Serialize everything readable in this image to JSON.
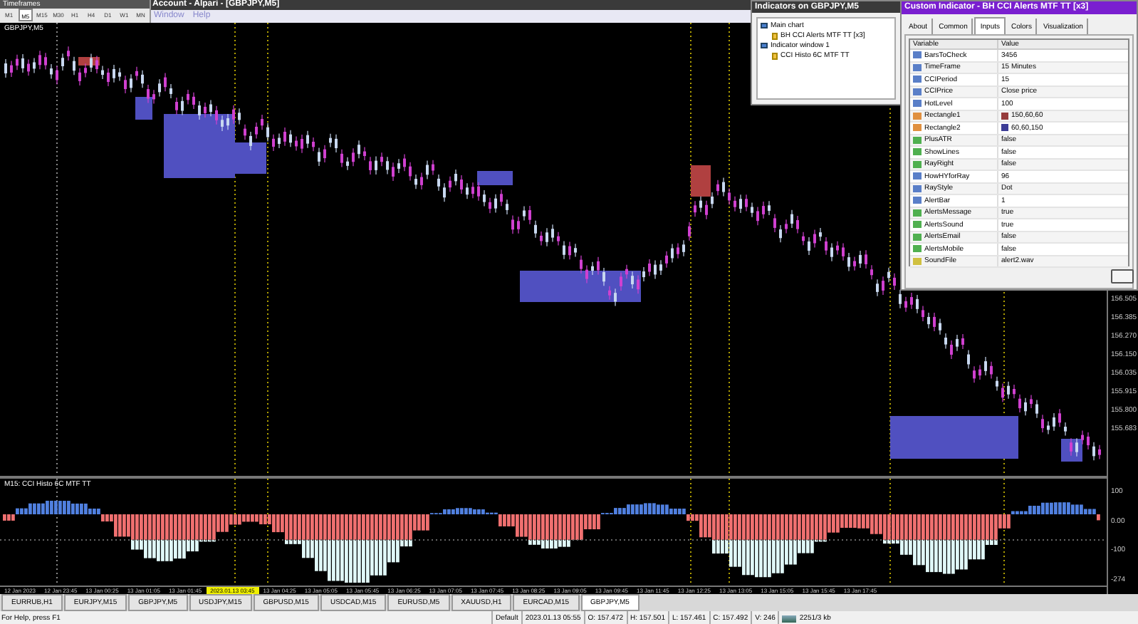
{
  "window": {
    "title": "Account - Alpari - [GBPJPY,M5]"
  },
  "menu": [
    "Window",
    "Help"
  ],
  "timeframes_toolbar": {
    "title": "Timeframes",
    "buttons": [
      {
        "label": "M1",
        "selected": false
      },
      {
        "label": "M5",
        "selected": true
      },
      {
        "label": "M15",
        "selected": false
      },
      {
        "label": "M30",
        "selected": false
      },
      {
        "label": "H1",
        "selected": false
      },
      {
        "label": "H4",
        "selected": false
      },
      {
        "label": "D1",
        "selected": false
      },
      {
        "label": "W1",
        "selected": false
      },
      {
        "label": "MN",
        "selected": false
      }
    ]
  },
  "chart": {
    "symbol_label": "GBPJPY,M5",
    "price_labels": [
      "156.505",
      "156.385",
      "156.270",
      "156.150",
      "156.035",
      "155.915",
      "155.800",
      "155.683"
    ],
    "indicator_label": "M15: CCI Histo 6C MTF TT",
    "indicator_levels": [
      "100",
      "0.00",
      "-100",
      "-274"
    ],
    "time_labels": [
      {
        "text": "12 Jan 2023",
        "highlighted": false
      },
      {
        "text": "12 Jan 23:45",
        "highlighted": false
      },
      {
        "text": "13 Jan 00:25",
        "highlighted": false
      },
      {
        "text": "13 Jan 01:05",
        "highlighted": false
      },
      {
        "text": "13 Jan 01:45",
        "highlighted": false
      },
      {
        "text": "2023.01.13 03:45",
        "highlighted": true
      },
      {
        "text": "13 Jan 04:25",
        "highlighted": false
      },
      {
        "text": "13 Jan 05:05",
        "highlighted": false
      },
      {
        "text": "13 Jan 05:45",
        "highlighted": false
      },
      {
        "text": "13 Jan 06:25",
        "highlighted": false
      },
      {
        "text": "13 Jan 07:05",
        "highlighted": false
      },
      {
        "text": "13 Jan 07:45",
        "highlighted": false
      },
      {
        "text": "13 Jan 08:25",
        "highlighted": false
      },
      {
        "text": "13 Jan 09:05",
        "highlighted": false
      },
      {
        "text": "13 Jan 09:45",
        "highlighted": false
      },
      {
        "text": "13 Jan 11:45",
        "highlighted": false
      },
      {
        "text": "13 Jan 12:25",
        "highlighted": false
      },
      {
        "text": "13 Jan 13:05",
        "highlighted": false
      },
      {
        "text": "13 Jan 15:05",
        "highlighted": false
      },
      {
        "text": "13 Jan 15:45",
        "highlighted": false
      },
      {
        "text": "13 Jan 17:45",
        "highlighted": false
      }
    ]
  },
  "indicators_dialog": {
    "title": "Indicators on GBPJPY,M5",
    "tree": [
      {
        "label": "Main chart",
        "children": [
          {
            "label": "BH CCI Alerts MTF TT [x3]"
          }
        ]
      },
      {
        "label": "Indicator window 1",
        "children": [
          {
            "label": "CCI Histo 6C MTF TT"
          }
        ]
      }
    ]
  },
  "custom_indicator_dialog": {
    "title": "Custom Indicator - BH CCI Alerts MTF TT [x3]",
    "tabs": [
      {
        "label": "About",
        "selected": false
      },
      {
        "label": "Common",
        "selected": false
      },
      {
        "label": "Inputs",
        "selected": true
      },
      {
        "label": "Colors",
        "selected": false
      },
      {
        "label": "Visualization",
        "selected": false
      }
    ],
    "columns": [
      "Variable",
      "Value"
    ],
    "rows": [
      {
        "kind": "number",
        "variable": "BarsToCheck",
        "value": "3456"
      },
      {
        "kind": "number",
        "variable": "TimeFrame",
        "value": "15 Minutes"
      },
      {
        "kind": "number",
        "variable": "CCIPeriod",
        "value": "15"
      },
      {
        "kind": "number",
        "variable": "CCIPrice",
        "value": "Close price"
      },
      {
        "kind": "number",
        "variable": "HotLevel",
        "value": "100"
      },
      {
        "kind": "color",
        "variable": "Rectangle1",
        "value": "150,60,60",
        "color": "#963c3c"
      },
      {
        "kind": "color",
        "variable": "Rectangle2",
        "value": "60,60,150",
        "color": "#3c3c96"
      },
      {
        "kind": "bool",
        "variable": "PlusATR",
        "value": "false"
      },
      {
        "kind": "bool",
        "variable": "ShowLines",
        "value": "false"
      },
      {
        "kind": "bool",
        "variable": "RayRight",
        "value": "false"
      },
      {
        "kind": "number",
        "variable": "HowHYforRay",
        "value": "96"
      },
      {
        "kind": "number",
        "variable": "RayStyle",
        "value": "Dot"
      },
      {
        "kind": "number",
        "variable": "AlertBar",
        "value": "1"
      },
      {
        "kind": "bool",
        "variable": "AlertsMessage",
        "value": "true"
      },
      {
        "kind": "bool",
        "variable": "AlertsSound",
        "value": "true"
      },
      {
        "kind": "bool",
        "variable": "AlertsEmail",
        "value": "false"
      },
      {
        "kind": "bool",
        "variable": "AlertsMobile",
        "value": "false"
      },
      {
        "kind": "string",
        "variable": "SoundFile",
        "value": "alert2.wav"
      }
    ]
  },
  "chart_tabs": [
    {
      "label": "EURRUB,H1",
      "selected": false
    },
    {
      "label": "EURJPY,M15",
      "selected": false
    },
    {
      "label": "GBPJPY,M5",
      "selected": false
    },
    {
      "label": "USDJPY,M15",
      "selected": false
    },
    {
      "label": "GBPUSD,M15",
      "selected": false
    },
    {
      "label": "USDCAD,M15",
      "selected": false
    },
    {
      "label": "EURUSD,M5",
      "selected": false
    },
    {
      "label": "XAUUSD,H1",
      "selected": false
    },
    {
      "label": "EURCAD,M15",
      "selected": false
    },
    {
      "label": "GBPJPY,M5",
      "selected": true
    }
  ],
  "status_bar": {
    "help": "For Help, press F1",
    "profile": "Default",
    "time": "2023.01.13 05:55",
    "open": "O: 157.472",
    "high": "H: 157.501",
    "low": "L: 157.461",
    "close": "C: 157.492",
    "volume": "V: 246",
    "traffic": "2251/3 kb"
  }
}
